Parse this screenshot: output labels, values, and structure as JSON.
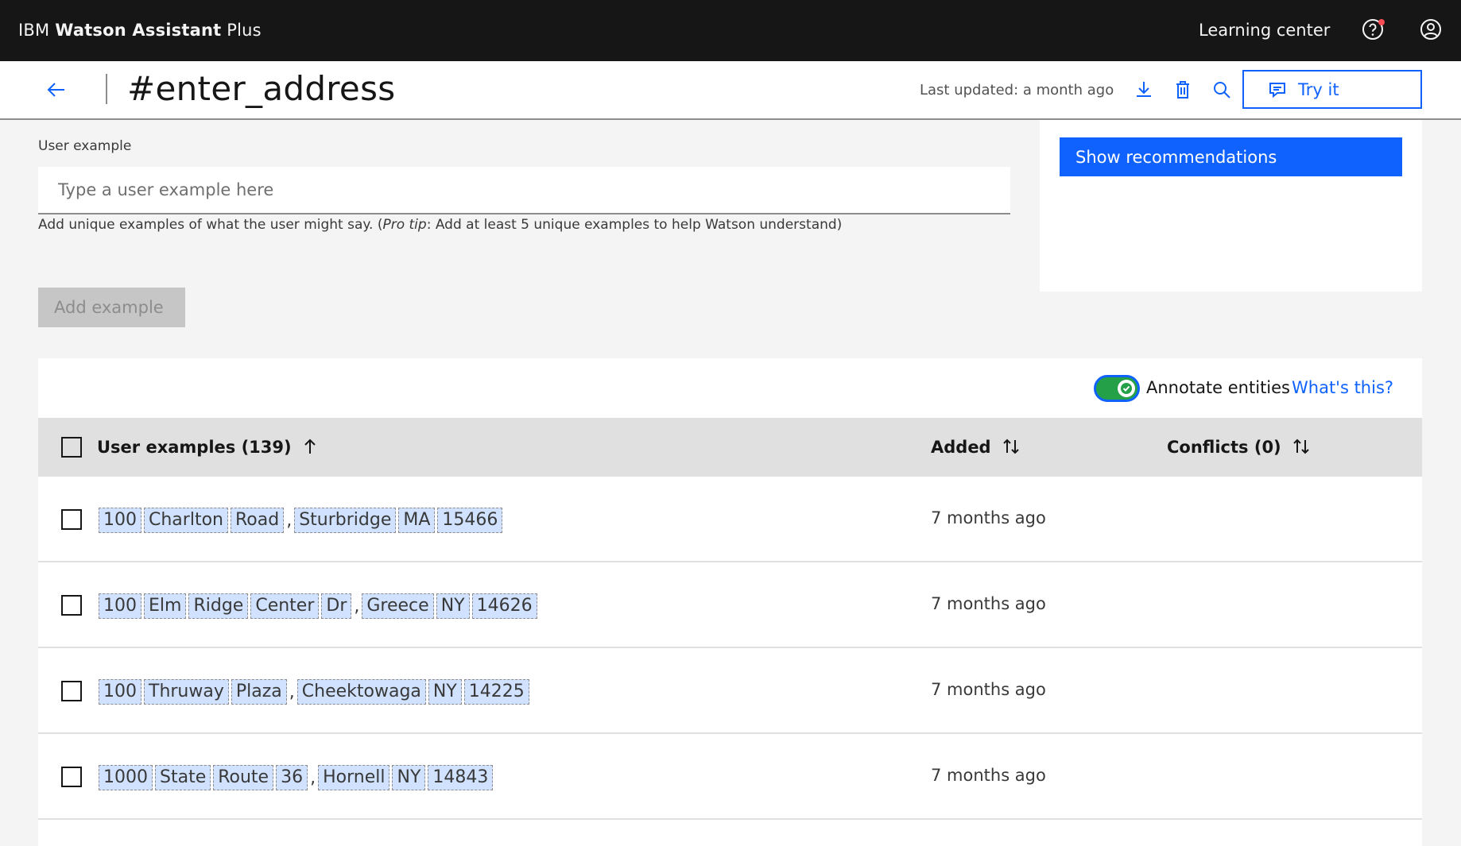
{
  "topbar": {
    "brand_prefix": "IBM ",
    "brand_bold": "Watson Assistant",
    "brand_suffix": " Plus",
    "learning_center": "Learning center"
  },
  "header": {
    "title": "#enter_address",
    "last_updated": "Last updated: a month ago",
    "try_it": "Try it"
  },
  "form": {
    "label": "User example",
    "placeholder": "Type a user example here",
    "help_prefix": "Add unique examples of what the user might say. (",
    "help_italic": "Pro tip",
    "help_suffix": ": Add at least 5 unique examples to help Watson understand)",
    "add_button": "Add example"
  },
  "recommendations": {
    "button": "Show recommendations"
  },
  "table": {
    "annotate_label": "Annotate entities",
    "whats_this": "What's this?",
    "annotate_enabled": true,
    "headers": {
      "examples": "User examples (139)",
      "added": "Added",
      "conflicts": "Conflicts (0)"
    },
    "rows": [
      {
        "tokens": [
          "100",
          "Charlton",
          "Road",
          ",",
          "Sturbridge",
          "MA",
          "15466"
        ],
        "added": "7 months ago"
      },
      {
        "tokens": [
          "100",
          "Elm",
          "Ridge",
          "Center",
          "Dr",
          ",",
          "Greece",
          "NY",
          "14626"
        ],
        "added": "7 months ago"
      },
      {
        "tokens": [
          "100",
          "Thruway",
          "Plaza",
          ",",
          "Cheektowaga",
          "NY",
          "14225"
        ],
        "added": "7 months ago"
      },
      {
        "tokens": [
          "1000",
          "State",
          "Route",
          "36",
          ",",
          "Hornell",
          "NY",
          "14843"
        ],
        "added": "7 months ago"
      }
    ]
  },
  "colors": {
    "primary": "#0f62fe",
    "topbar": "#161616",
    "toggle_on": "#24a148",
    "entity_highlight": "#d0e2ff"
  }
}
